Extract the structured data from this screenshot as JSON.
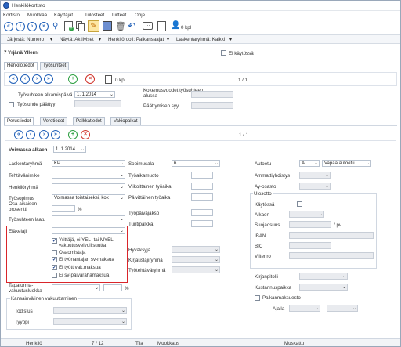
{
  "app": {
    "title": "Henkilökortisto"
  },
  "menu": [
    "Kortisto",
    "Muokkaa",
    "Käyttäjät",
    "Tulosteet",
    "Liitteet",
    "Ohje"
  ],
  "toolbar": {
    "count": "0 kpl"
  },
  "filters": {
    "jarjesta": "Järjestä: Numero",
    "nayta": "Näytä: Aktiiviset",
    "henkilorooli": "Henkilörooli: Palkansaajat",
    "laskentaryhma": "Laskentaryhmä: Kaikki",
    "ei_kaytossa": "Ei käytössä"
  },
  "person": {
    "name": "7 Yrjänä Yllerni"
  },
  "main_tabs": [
    "Henkilötiedot",
    "Työsuhteet"
  ],
  "employment": {
    "count": "0 kpl",
    "pager": "1 / 1",
    "alkamispaiva_label": "Työsuhteen alkamispäivä",
    "alkamispaiva_value": "1. 1.2014",
    "paattyy_label": "Työsuhde päättyy",
    "kokemus_label": "Kokemusvuodet työsuhteen alussa",
    "paattymisen_syy_label": "Päättymisen syy"
  },
  "sub_tabs": [
    "Perustiedot",
    "Verotiedot",
    "Palkkatiedot",
    "Vakiopalkat"
  ],
  "period": {
    "pager": "1 / 1",
    "label": "Voimassa alkaen",
    "value": "1. 1.2014"
  },
  "left_form": {
    "laskentaryhma_label": "Laskentaryhmä",
    "laskentaryhma_value": "KP",
    "tehtavanimike_label": "Tehtävänimike",
    "henkiloryhma_label": "Henkilöryhmä",
    "tyosopimus_label": "Työsopimus",
    "tyosopimus_value": "Voimassa toistaiseksi, kok",
    "osa_aikaisen_label": "Osa-aikaisen prosentti",
    "percent": "%",
    "tyosuhteen_laatu_label": "Työsuhteen laatu",
    "elakelaji_label": "Eläkelaji",
    "options": [
      "Yrittäjä, ei YEL- tai MYEL-vakuutusvelvollisuutta",
      "Osaomistaja",
      "Ei työnantajan sv-maksua",
      "Ei tyött.vak.maksua",
      "Ei sv-päivärahamaksua"
    ],
    "options_checked": [
      "✓",
      "",
      "✓",
      "✓",
      ""
    ],
    "tapaturma_label": "Tapaturma-vakuutusluokka",
    "percent2": "%",
    "kansainvalinen_legend": "Kansainvälinen vakuuttaminen",
    "todistus_label": "Todistus",
    "tyyppi_label": "Tyyppi"
  },
  "mid_form": {
    "sopimusala_label": "Sopimusala",
    "sopimusala_value": "6",
    "tyoaikamuoto_label": "Työaikamuoto",
    "viikoittainen_label": "Viikoittainen työaika",
    "paivittainen_label": "Päivittäinen työaika",
    "tyopaivajakso_label": "Työpäiväjakso",
    "tuntipalkka_label": "Tuntipalkka",
    "hyvaksyja_label": "Hyväksyjä",
    "kirjauslajiryhma_label": "Kirjauslajiryhmä",
    "tyotehtavaryhma_label": "Työtehtäväryhmä"
  },
  "right_form": {
    "autoetu_label": "Autoetu",
    "autoetu_code": "A",
    "autoetu_value": "Vapaa autoetu",
    "ammattiyhdistys_label": "Ammattiyhdistys",
    "ay_osasto_label": "Ay-osasto",
    "ulosotto_legend": "Ulosotto",
    "kaytossa_label": "Käytössä",
    "alkaen_label": "Alkaen",
    "suojaosuus_label": "Suojaosuus",
    "per_pv": "/ pv",
    "iban_label": "IBAN",
    "bic_label": "BIC",
    "viitenro_label": "Viitenro",
    "kirjanpitolii_label": "Kirjanpitolii",
    "kustannuspaikka_label": "Kustannuspaikka",
    "palkanmaksuesto_label": "Palkanmaksuesto",
    "ajalla_label": "Ajalla",
    "dash": "-"
  },
  "status": {
    "henkilo": "Henkilö",
    "position": "7 / 12",
    "tila": "Tila",
    "muokkaus": "Muokkaus",
    "muskattu": "Muskattu"
  }
}
